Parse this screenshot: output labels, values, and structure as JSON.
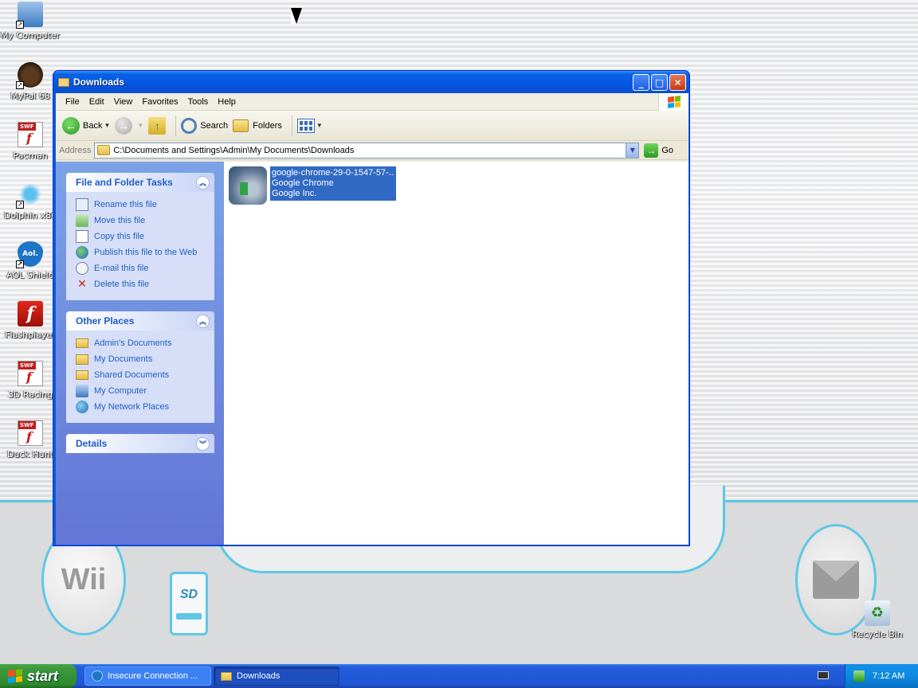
{
  "desktop": {
    "icons": [
      {
        "label": "My Computer",
        "icon": "my-computer-icon"
      },
      {
        "label": "MyPal 68",
        "icon": "mypal-icon"
      },
      {
        "label": "Pacman",
        "icon": "swf-file-icon"
      },
      {
        "label": "Dolphin x86",
        "icon": "dolphin-icon"
      },
      {
        "label": "AOL Shield",
        "icon": "aol-shield-icon"
      },
      {
        "label": "Flashplayer",
        "icon": "flash-icon"
      },
      {
        "label": "3D Racing",
        "icon": "swf-file-icon"
      },
      {
        "label": "Duck Hunt",
        "icon": "swf-file-icon"
      },
      {
        "label": "Recycle Bin",
        "icon": "recycle-bin-icon"
      }
    ],
    "wallpaper": {
      "wii_label": "Wii",
      "sd_label": "SD"
    }
  },
  "window": {
    "title": "Downloads",
    "menu": [
      "File",
      "Edit",
      "View",
      "Favorites",
      "Tools",
      "Help"
    ],
    "toolbar": {
      "back_label": "Back",
      "search_label": "Search",
      "folders_label": "Folders"
    },
    "address": {
      "label": "Address",
      "value": "C:\\Documents and Settings\\Admin\\My Documents\\Downloads",
      "go_label": "Go"
    },
    "tasks_panel": {
      "title": "File and Folder Tasks",
      "items": [
        "Rename this file",
        "Move this file",
        "Copy this file",
        "Publish this file to the Web",
        "E-mail this file",
        "Delete this file"
      ]
    },
    "other_places": {
      "title": "Other Places",
      "items": [
        "Admin's Documents",
        "My Documents",
        "Shared Documents",
        "My Computer",
        "My Network Places"
      ]
    },
    "details": {
      "title": "Details"
    },
    "files": [
      {
        "name": "google-chrome-29-0-1547-57-...",
        "description": "Google Chrome",
        "company": "Google Inc."
      }
    ]
  },
  "taskbar": {
    "start_label": "start",
    "tasks": [
      {
        "label": "Insecure Connection ...",
        "active": false
      },
      {
        "label": "Downloads",
        "active": true
      }
    ],
    "clock": "7:12 AM"
  },
  "colors": {
    "title_blue": "#0454e0",
    "taskpane_link": "#215dc6",
    "selection": "#316ac5",
    "start_green": "#3a9a3a",
    "wii_accent": "#5ec7e6"
  }
}
